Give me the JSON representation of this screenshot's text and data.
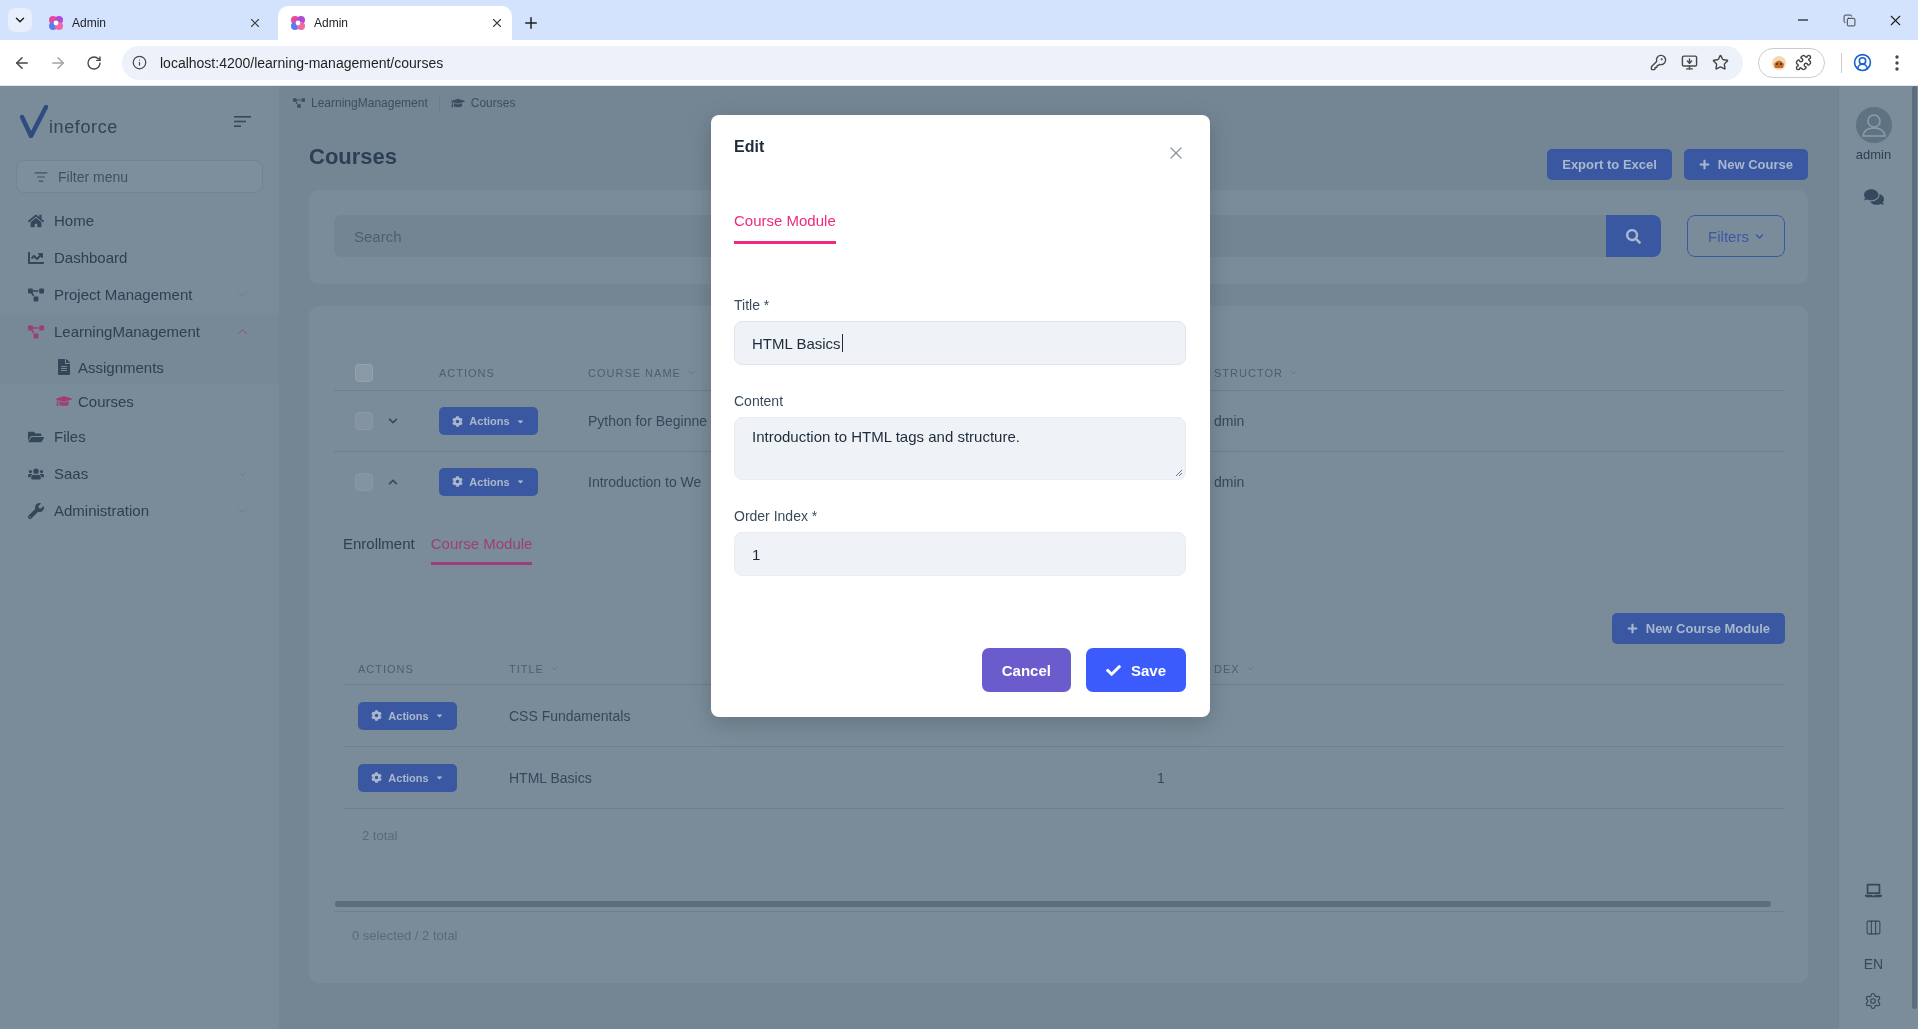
{
  "browser": {
    "tabs": [
      {
        "title": "Admin",
        "selected": false
      },
      {
        "title": "Admin",
        "selected": true
      }
    ],
    "url": "localhost:4200/learning-management/courses"
  },
  "sidebar": {
    "logo": "ineforce",
    "filter_placeholder": "Filter menu",
    "items": [
      {
        "label": "Home",
        "selected": false
      },
      {
        "label": "Dashboard",
        "selected": false
      },
      {
        "label": "Project Management",
        "selected": false,
        "expanded": false
      },
      {
        "label": "LearningManagement",
        "selected": true,
        "expanded": true,
        "children": [
          {
            "label": "Assignments",
            "selected": false
          },
          {
            "label": "Courses",
            "selected": true
          }
        ]
      },
      {
        "label": "Files",
        "selected": false
      },
      {
        "label": "Saas",
        "selected": false,
        "expanded": false
      },
      {
        "label": "Administration",
        "selected": false,
        "expanded": false
      }
    ]
  },
  "breadcrumb": [
    "LearningManagement",
    "Courses"
  ],
  "page": {
    "title": "Courses",
    "buttons": [
      {
        "label": "Export to Excel",
        "kind": "plain"
      },
      {
        "label": "New Course",
        "kind": "add"
      }
    ]
  },
  "search": {
    "placeholder": "Search",
    "filters_button": "Filters"
  },
  "courses_table": {
    "all_checked": false,
    "columns": [
      {
        "label": "ACTIONS",
        "sortable": false
      },
      {
        "label": "COURSE NAME",
        "sortable": true
      },
      {
        "label": "STRUCTOR",
        "sortable": true
      }
    ],
    "rows": [
      {
        "checked": false,
        "expanded": false,
        "action": "Actions",
        "course_name": "Python for Beginne",
        "instructor": "dmin"
      },
      {
        "checked": false,
        "expanded": true,
        "action": "Actions",
        "course_name": "Introduction to We",
        "instructor": "dmin"
      }
    ]
  },
  "detail": {
    "tabs": [
      {
        "label": "Enrollment",
        "selected": false
      },
      {
        "label": "Course Module",
        "selected": true
      }
    ],
    "add_button": "New Course Module",
    "columns": [
      {
        "label": "ACTIONS",
        "sortable": false
      },
      {
        "label": "TITLE",
        "sortable": true
      },
      {
        "label": "DEX",
        "sortable": true
      }
    ],
    "rows": [
      {
        "action": "Actions",
        "title": "CSS Fundamentals"
      },
      {
        "action": "Actions",
        "title": "HTML Basics",
        "order_index": "1"
      }
    ],
    "total": "2 total"
  },
  "footer": {
    "selection": "0 selected / 2 total"
  },
  "right_rail": {
    "user": "admin",
    "language": "EN"
  },
  "modal": {
    "title": "Edit",
    "tabs": [
      {
        "label": "Course Module",
        "selected": true
      }
    ],
    "fields": [
      {
        "label": "Title *",
        "kind": "text",
        "value": "HTML Basics",
        "focused": true
      },
      {
        "label": "Content",
        "kind": "textarea",
        "value": "Introduction to HTML tags and structure.",
        "focused": false
      },
      {
        "label": "Order Index *",
        "kind": "text",
        "value": "1",
        "focused": false
      }
    ],
    "buttons": [
      {
        "label": "Cancel",
        "kind": "secondary"
      },
      {
        "label": "Save",
        "kind": "primary"
      }
    ]
  }
}
